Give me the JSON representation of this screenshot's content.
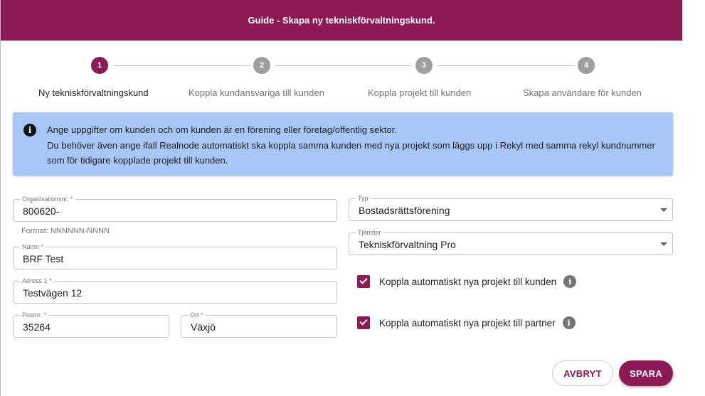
{
  "dialog": {
    "title": "Guide - Skapa ny teknisk​förvaltningskund."
  },
  "stepper": {
    "steps": [
      {
        "number": "1",
        "label": "Ny tekniskförvaltningskund",
        "active": true
      },
      {
        "number": "2",
        "label": "Koppla kundansvariga till kunden",
        "active": false
      },
      {
        "number": "3",
        "label": "Koppla projekt till kunden",
        "active": false
      },
      {
        "number": "4",
        "label": "Skapa användare för kunden",
        "active": false
      }
    ]
  },
  "info": {
    "icon": "info-icon",
    "line1": "Ange uppgifter om kunden och om kunden är en förening eller företag/offentlig sektor.",
    "line2": "Du behöver även ange ifall Realnode automatiskt ska koppla samma kunden med nya projekt som läggs upp i Rekyl med samma rekyl kundnummer som för tidigare kopplade projekt till kunden."
  },
  "form": {
    "org_nr": {
      "label": "Organisationsnr. *",
      "value": "800620-",
      "helper": "Format: NNNNNN-NNNN"
    },
    "name": {
      "label": "Namn *",
      "value": "BRF Test"
    },
    "address": {
      "label": "Adress 1 *",
      "value": "Testvägen 12"
    },
    "postal": {
      "label": "Postnr. *",
      "value": "35264"
    },
    "city": {
      "label": "Ort *",
      "value": "Växjö"
    },
    "type": {
      "label": "Typ",
      "value": "Bostadsrättsförening"
    },
    "services": {
      "label": "Tjänster",
      "value": "Tekniskförvaltning Pro"
    },
    "auto_project": {
      "label": "Koppla automatiskt nya projekt till kunden",
      "checked": true
    },
    "auto_partner": {
      "label": "Koppla automatiskt nya projekt till partner",
      "checked": true
    }
  },
  "actions": {
    "cancel_label": "AVBRYT",
    "save_label": "SPARA"
  },
  "colors": {
    "brand": "#8e1a55",
    "info_bg": "#a6c7f7"
  }
}
